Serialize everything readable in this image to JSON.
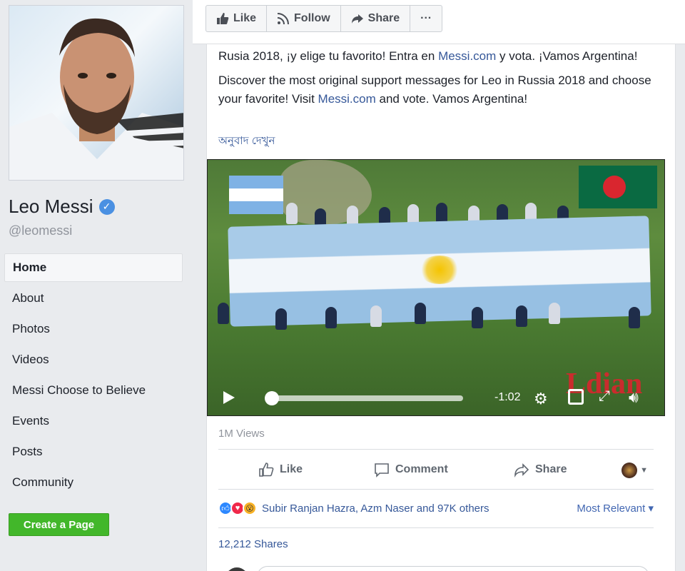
{
  "sidebar": {
    "name": "Leo Messi",
    "handle": "@leomessi",
    "nav": [
      "Home",
      "About",
      "Photos",
      "Videos",
      "Messi Choose to Believe",
      "Events",
      "Posts",
      "Community"
    ],
    "create_page": "Create a Page"
  },
  "actionbar": {
    "like": "Like",
    "follow": "Follow",
    "share": "Share",
    "more": "···"
  },
  "post": {
    "text_es_prefix": "Rusia 2018, ¡y elige tu favorito! Entra en ",
    "text_es_link": "Messi.com",
    "text_es_suffix": " y vota. ¡Vamos Argentina!",
    "text_en_prefix": "Discover the most original support messages for Leo in Russia 2018 and choose your favorite! Visit ",
    "text_en_link": "Messi.com",
    "text_en_suffix": " and vote. Vamos Argentina!",
    "translate": "অনুবাদ দেখুন",
    "video": {
      "time_remaining": "-1:02",
      "progress": 0.03
    },
    "views": "1M Views",
    "like": "Like",
    "comment": "Comment",
    "share": "Share",
    "reaction_names": "Subir Ranjan Hazra, Azm Naser and 97K others",
    "most_relevant": "Most Relevant ▾",
    "shares": "12,212 Shares"
  }
}
